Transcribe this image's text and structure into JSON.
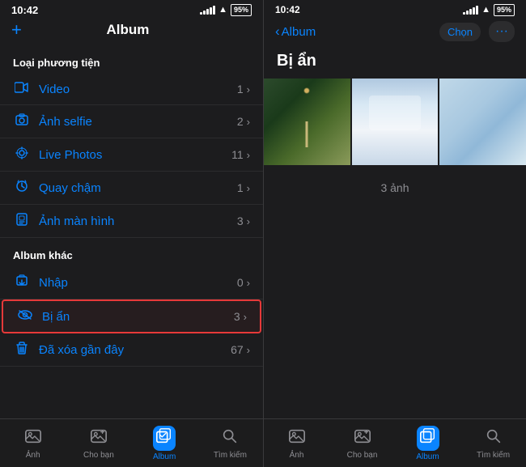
{
  "left": {
    "statusBar": {
      "time": "10:42",
      "battery": "95%"
    },
    "header": {
      "addIcon": "+",
      "title": "Album"
    },
    "sections": [
      {
        "id": "loai-phuong-tien",
        "header": "Loại phương tiện",
        "items": [
          {
            "id": "video",
            "icon": "📹",
            "label": "Video",
            "count": "1"
          },
          {
            "id": "anh-selfie",
            "icon": "🤳",
            "label": "Ảnh selfie",
            "count": "2"
          },
          {
            "id": "live-photos",
            "icon": "⊙",
            "label": "Live Photos",
            "count": "11"
          },
          {
            "id": "quay-cham",
            "icon": "✳",
            "label": "Quay chậm",
            "count": "1"
          },
          {
            "id": "anh-man-hinh",
            "icon": "📷",
            "label": "Ảnh màn hình",
            "count": "3"
          }
        ]
      },
      {
        "id": "album-khac",
        "header": "Album khác",
        "items": [
          {
            "id": "nhap",
            "icon": "⬇",
            "label": "Nhập",
            "count": "0",
            "highlighted": false
          },
          {
            "id": "bi-an",
            "icon": "👁",
            "label": "Bị ẩn",
            "count": "3",
            "highlighted": true
          },
          {
            "id": "da-xoa",
            "icon": "🗑",
            "label": "Đã xóa gần đây",
            "count": "67",
            "highlighted": false
          }
        ]
      }
    ],
    "tabBar": [
      {
        "id": "anh",
        "label": "Ảnh",
        "active": false
      },
      {
        "id": "cho-ban",
        "label": "Cho bạn",
        "active": false
      },
      {
        "id": "album",
        "label": "Album",
        "active": true
      },
      {
        "id": "tim-kiem",
        "label": "Tìm kiếm",
        "active": false
      }
    ]
  },
  "right": {
    "statusBar": {
      "time": "10:42",
      "battery": "95%"
    },
    "header": {
      "backLabel": "Album",
      "chonLabel": "Chọn",
      "moreLabel": "···"
    },
    "albumTitle": "Bị ẩn",
    "photoCount": "3 ảnh",
    "tabBar": [
      {
        "id": "anh",
        "label": "Ảnh",
        "active": false
      },
      {
        "id": "cho-ban",
        "label": "Cho bạn",
        "active": false
      },
      {
        "id": "album",
        "label": "Album",
        "active": true
      },
      {
        "id": "tim-kiem",
        "label": "Tìm kiếm",
        "active": false
      }
    ]
  }
}
